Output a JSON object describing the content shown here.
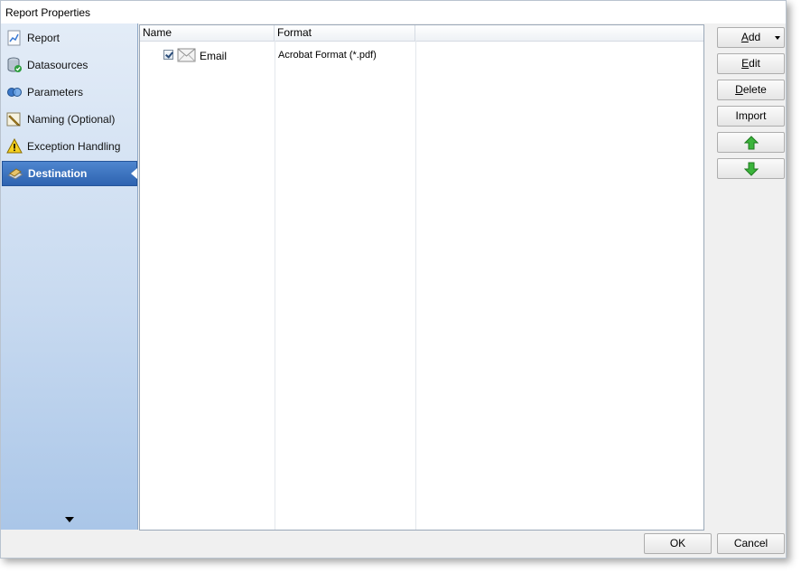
{
  "window": {
    "title": "Report Properties"
  },
  "sidebar": {
    "items": [
      {
        "label": "Report",
        "icon": "report-chart-icon",
        "active": false
      },
      {
        "label": "Datasources",
        "icon": "database-icon",
        "active": false
      },
      {
        "label": "Parameters",
        "icon": "parameters-icon",
        "active": false
      },
      {
        "label": "Naming (Optional)",
        "icon": "pencil-icon",
        "active": false
      },
      {
        "label": "Exception Handling",
        "icon": "warning-icon",
        "active": false
      },
      {
        "label": "Destination",
        "icon": "destination-icon",
        "active": true
      }
    ],
    "scroll_icon": "chevron-down-icon"
  },
  "list": {
    "columns": [
      "Name",
      "Format",
      ""
    ],
    "rows": [
      {
        "checked": true,
        "icon": "envelope-icon",
        "name": "Email",
        "format": "Acrobat Format (*.pdf)"
      }
    ]
  },
  "buttons": {
    "add": {
      "accel": "A",
      "rest": "dd"
    },
    "edit": {
      "accel": "E",
      "rest": "dit"
    },
    "delete": {
      "accel": "D",
      "rest": "elete"
    },
    "import": "Import",
    "move_up_icon": "arrow-up-icon",
    "move_down_icon": "arrow-down-icon"
  },
  "footer": {
    "ok": {
      "accel": "O",
      "rest": "K"
    },
    "cancel": {
      "accel": "C",
      "rest": "ancel"
    }
  },
  "colors": {
    "active_nav": "#3a72c0",
    "arrow_green": "#3bb43b"
  }
}
